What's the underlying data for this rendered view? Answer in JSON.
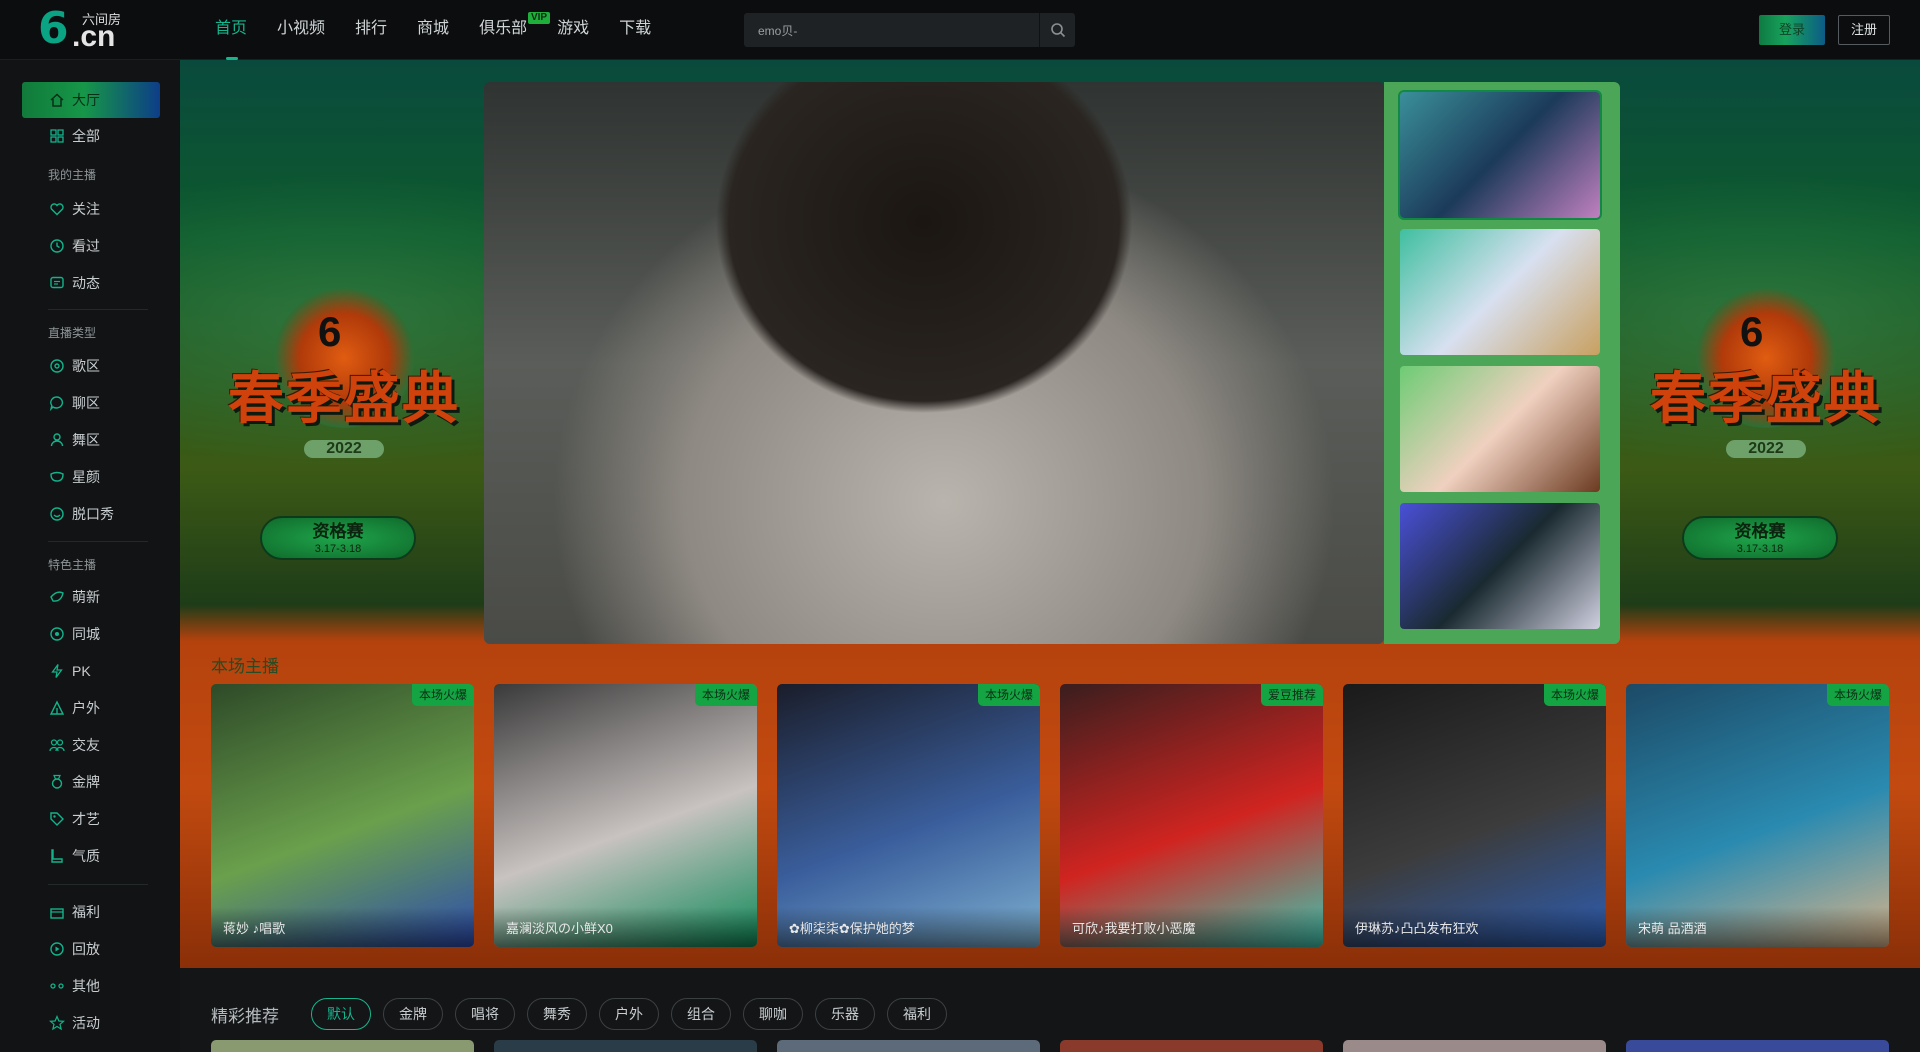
{
  "header": {
    "logo_six": "6",
    "logo_cn": ".cn",
    "logo_zh": "六间房",
    "nav": [
      {
        "label": "首页",
        "active": true
      },
      {
        "label": "小视频",
        "active": false
      },
      {
        "label": "排行",
        "active": false
      },
      {
        "label": "商城",
        "active": false
      },
      {
        "label": "俱乐部",
        "active": false,
        "badge": "VIP"
      },
      {
        "label": "游戏",
        "active": false
      },
      {
        "label": "下载",
        "active": false
      }
    ],
    "search_value": "emo贝-",
    "login_label": "登录",
    "register_label": "注册"
  },
  "sidebar": {
    "top": [
      {
        "label": "大厅",
        "icon": "home-icon",
        "active": true
      },
      {
        "label": "全部",
        "icon": "grid-icon"
      }
    ],
    "group_my": "我的主播",
    "my": [
      {
        "label": "关注",
        "icon": "heart-icon"
      },
      {
        "label": "看过",
        "icon": "clock-icon"
      },
      {
        "label": "动态",
        "icon": "message-icon"
      }
    ],
    "group_type": "直播类型",
    "types": [
      {
        "label": "歌区",
        "icon": "music-icon"
      },
      {
        "label": "聊区",
        "icon": "chat-icon"
      },
      {
        "label": "舞区",
        "icon": "dance-icon"
      },
      {
        "label": "星颜",
        "icon": "mask-icon"
      },
      {
        "label": "脱口秀",
        "icon": "mic-icon"
      }
    ],
    "group_feature": "特色主播",
    "features": [
      {
        "label": "萌新",
        "icon": "leaf-icon"
      },
      {
        "label": "同城",
        "icon": "location-icon"
      },
      {
        "label": "PK",
        "icon": "lightning-icon"
      },
      {
        "label": "户外",
        "icon": "tent-icon"
      },
      {
        "label": "交友",
        "icon": "friends-icon"
      },
      {
        "label": "金牌",
        "icon": "medal-icon"
      },
      {
        "label": "才艺",
        "icon": "tag-icon"
      },
      {
        "label": "气质",
        "icon": "boot-icon"
      }
    ],
    "bottom": [
      {
        "label": "福利",
        "icon": "gift-icon"
      },
      {
        "label": "回放",
        "icon": "replay-icon"
      },
      {
        "label": "其他",
        "icon": "more-icon"
      },
      {
        "label": "活动",
        "icon": "star-icon"
      }
    ]
  },
  "banner": {
    "event_title": "春季盛典",
    "event_year": "2022",
    "event_stage": "资格赛",
    "event_dates": "3.17-3.18",
    "hot_title": "本场主播"
  },
  "hot_cards": [
    {
      "name": "蒋妙 ♪唱歌",
      "tag": "本场火爆",
      "colors": [
        "#2e4a28",
        "#6aa04c",
        "#2d4cb0"
      ]
    },
    {
      "name": "嘉澜淡风の小鲜X0",
      "tag": "本场火爆",
      "colors": [
        "#3a3a3a",
        "#c8c2c0",
        "#0f8a58"
      ]
    },
    {
      "name": "✿柳柒柒✿保护她的梦",
      "tag": "本场火爆",
      "colors": [
        "#1a1d2a",
        "#3a5e9c",
        "#7db0d0"
      ]
    },
    {
      "name": "可欣♪我要打败小恶魔",
      "tag": "爱豆推荐",
      "colors": [
        "#3a1e1e",
        "#d02420",
        "#3ec5b0"
      ]
    },
    {
      "name": "伊琳苏♪凸凸发布狂欢",
      "tag": "本场火爆",
      "colors": [
        "#1a1a1a",
        "#3c3c3c",
        "#2d5db3"
      ]
    },
    {
      "name": "宋萌 品酒酒",
      "tag": "本场火爆",
      "colors": [
        "#1c4a66",
        "#2a8ab0",
        "#d8b48a"
      ]
    }
  ],
  "recommend": {
    "title": "精彩推荐",
    "filters": [
      {
        "label": "默认",
        "active": true
      },
      {
        "label": "金牌"
      },
      {
        "label": "唱将"
      },
      {
        "label": "舞秀"
      },
      {
        "label": "户外"
      },
      {
        "label": "组合"
      },
      {
        "label": "聊咖"
      },
      {
        "label": "乐器"
      },
      {
        "label": "福利"
      }
    ]
  }
}
